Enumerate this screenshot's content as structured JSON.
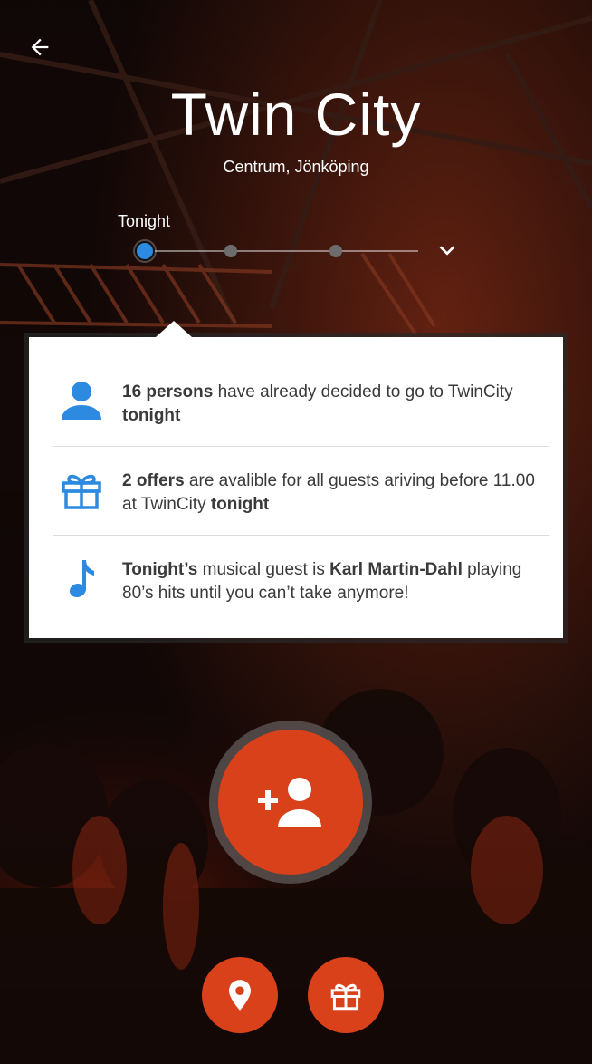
{
  "venue": {
    "title": "Twin City",
    "location": "Centrum, Jönköping"
  },
  "slider": {
    "label": "Tonight",
    "selected_index": 0,
    "stops": 3
  },
  "info": [
    {
      "icon": "person-icon",
      "segments": [
        {
          "t": "16 persons",
          "b": true
        },
        {
          "t": " have already decided to go to TwinCity ",
          "b": false
        },
        {
          "t": "tonight",
          "b": true
        }
      ]
    },
    {
      "icon": "gift-icon",
      "segments": [
        {
          "t": "2 offers",
          "b": true
        },
        {
          "t": " are avalible for all guests ariving before 11.00 at TwinCity ",
          "b": false
        },
        {
          "t": "tonight",
          "b": true
        }
      ]
    },
    {
      "icon": "music-note-icon",
      "segments": [
        {
          "t": "Tonight’s",
          "b": true
        },
        {
          "t": " musical guest is ",
          "b": false
        },
        {
          "t": "Karl Martin-Dahl",
          "b": true
        },
        {
          "t": " playing 80’s hits until you can’t take anymore!",
          "b": false
        }
      ]
    }
  ],
  "actions": {
    "primary_icon": "add-person-icon",
    "secondary": [
      {
        "icon": "location-pin-icon"
      },
      {
        "icon": "gift-icon"
      }
    ]
  },
  "colors": {
    "accent": "#d8411a",
    "info_icon": "#2c8be0",
    "slider_active": "#2c8be0"
  }
}
